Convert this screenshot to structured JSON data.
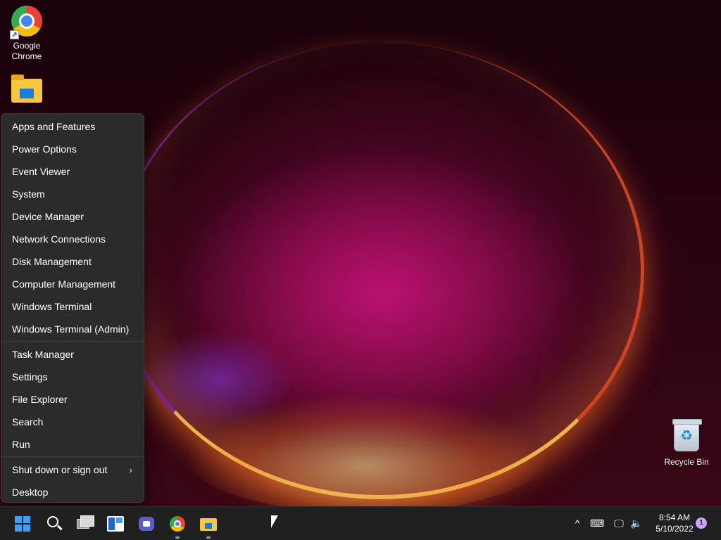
{
  "desktop": {
    "icons": [
      {
        "label": "Google\nChrome",
        "icon": "chrome-icon"
      },
      {
        "label": "",
        "icon": "file-explorer-folder-icon"
      },
      {
        "label": "Recycle Bin",
        "icon": "recycle-bin-icon"
      }
    ]
  },
  "winx_menu": {
    "group1": [
      "Apps and Features",
      "Power Options",
      "Event Viewer",
      "System",
      "Device Manager",
      "Network Connections",
      "Disk Management",
      "Computer Management",
      "Windows Terminal",
      "Windows Terminal (Admin)"
    ],
    "group2": [
      "Task Manager",
      "Settings",
      "File Explorer",
      "Search",
      "Run"
    ],
    "group3": [
      {
        "label": "Shut down or sign out",
        "submenu_icon": "chevron-right-icon",
        "submenu_glyph": "›"
      },
      {
        "label": "Desktop"
      }
    ]
  },
  "taskbar": {
    "apps": [
      "start-icon",
      "search-icon",
      "task-view-icon",
      "widgets-icon",
      "chat-icon",
      "chrome-icon",
      "file-explorer-icon"
    ],
    "tray": {
      "chevron_glyph": "^",
      "keyboard_glyph": "⌨",
      "network_glyph": "🖵",
      "volume_glyph": "🔈"
    },
    "clock": {
      "time": "8:54 AM",
      "date": "5/10/2022"
    },
    "notification_count": "1"
  },
  "colors": {
    "menu_bg": "#2b2b2b",
    "taskbar_bg": "#202020",
    "accent": "#3aa0ff",
    "badge": "#c9a3ff"
  }
}
